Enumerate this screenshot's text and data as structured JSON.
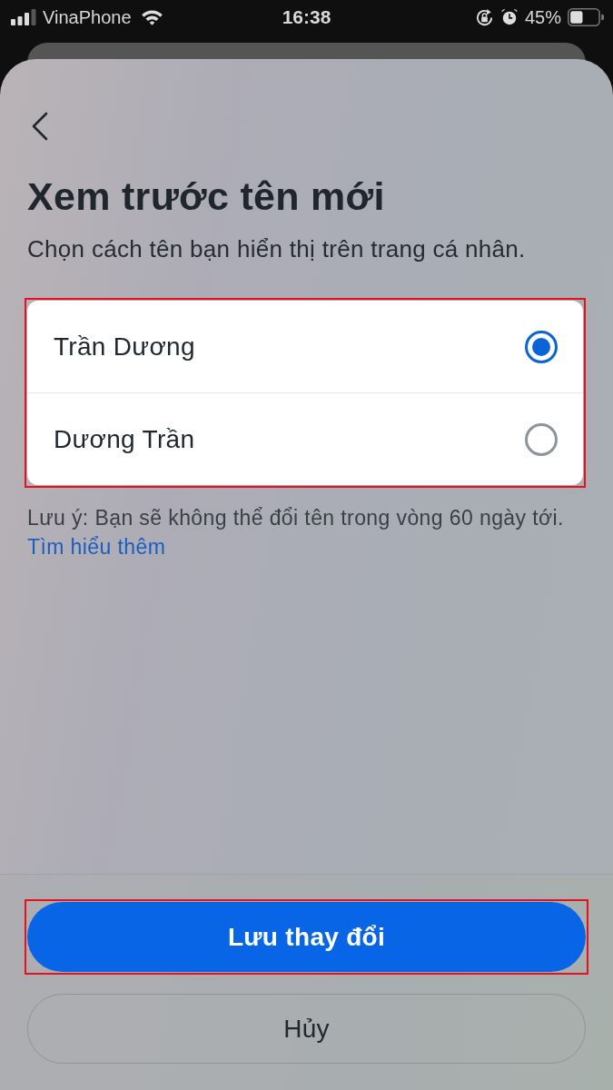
{
  "status_bar": {
    "carrier": "VinaPhone",
    "time": "16:38",
    "battery": "45%"
  },
  "sheet": {
    "title": "Xem trước tên mới",
    "subtitle": "Chọn cách tên bạn hiển thị trên trang cá nhân.",
    "options_highlighted": true,
    "options": [
      {
        "label": "Trần Dương",
        "selected": true
      },
      {
        "label": "Dương Trần",
        "selected": false
      }
    ],
    "note": "Lưu ý: Bạn sẽ không thể đổi tên trong vòng 60 ngày tới.",
    "link": "Tìm hiểu thêm"
  },
  "buttons": [
    {
      "label": "Lưu thay đổi",
      "kind": "primary",
      "highlighted": true
    },
    {
      "label": "Hủy",
      "kind": "secondary",
      "highlighted": false
    }
  ]
}
